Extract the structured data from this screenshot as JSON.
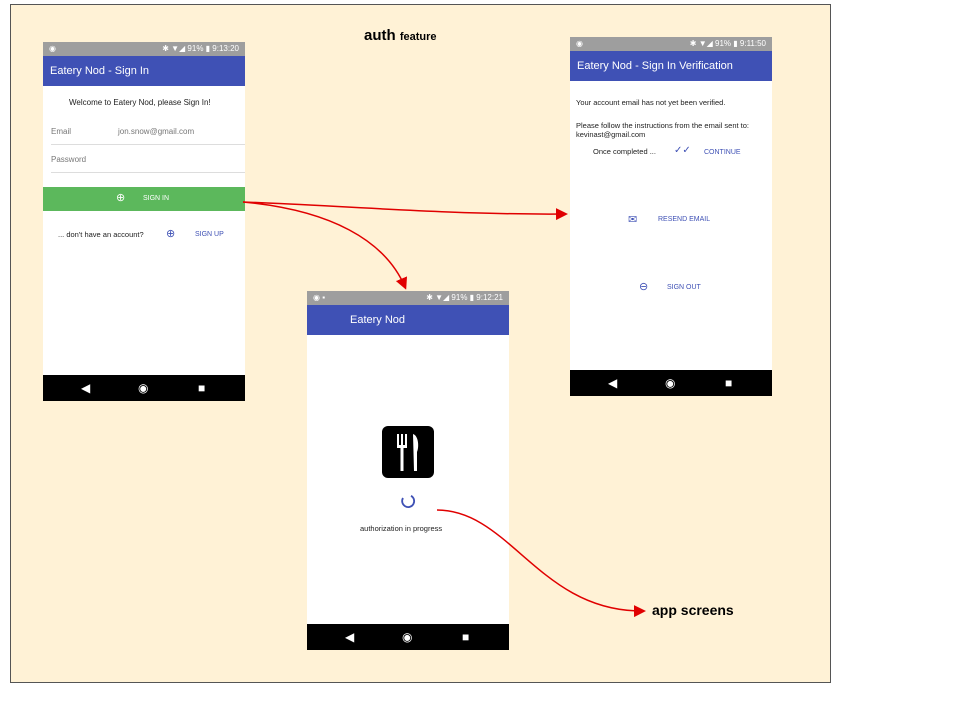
{
  "diagram": {
    "title_main": "auth",
    "title_sub": "feature",
    "destination_label": "app screens"
  },
  "signin_screen": {
    "status_time": "9:13:20",
    "status_battery": "91%",
    "app_title": "Eatery Nod - Sign In",
    "welcome": "Welcome to Eatery Nod, please Sign In!",
    "email_label": "Email",
    "email_value": "jon.snow@gmail.com",
    "password_label": "Password",
    "signin_label": "SIGN IN",
    "no_account_text": "... don't have an account?",
    "signup_label": "SIGN UP"
  },
  "verification_screen": {
    "status_time": "9:11:50",
    "status_battery": "91%",
    "app_title": "Eatery Nod - Sign In Verification",
    "not_verified": "Your account email has not yet been verified.",
    "instructions": "Please follow the instructions from the email sent to: kevinast@gmail.com",
    "once_completed": "Once completed ...",
    "continue_label": "CONTINUE",
    "resend_label": "RESEND EMAIL",
    "signout_label": "SIGN OUT"
  },
  "progress_screen": {
    "status_time": "9:12:21",
    "status_battery": "91%",
    "app_title": "Eatery Nod",
    "progress_text": "authorization in progress"
  },
  "colors": {
    "appbar": "#3f51b5",
    "signin_button": "#5cb85c",
    "arrow": "#e00000",
    "board": "#fff2d6"
  }
}
